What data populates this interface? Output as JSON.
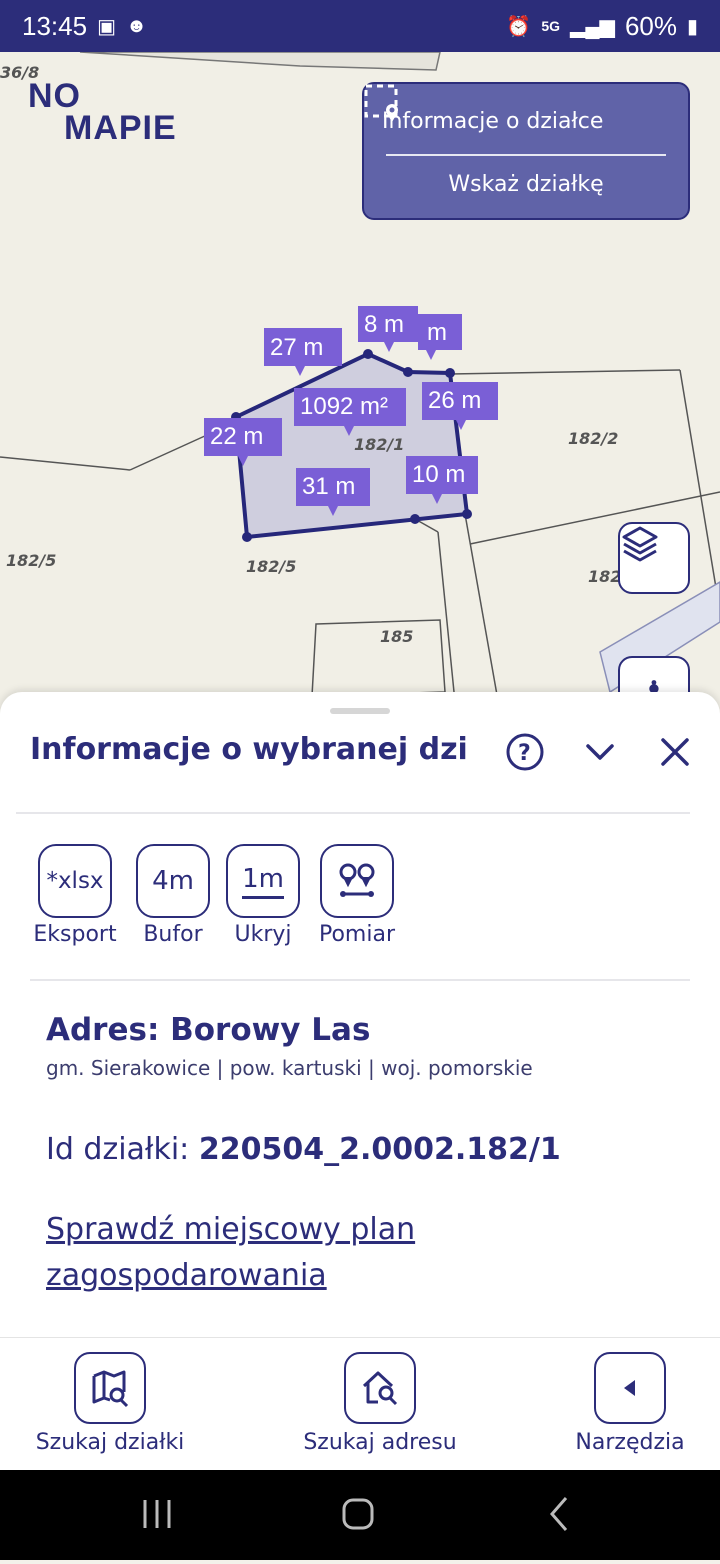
{
  "status_bar": {
    "time": "13:45",
    "network": "5G",
    "battery": "60%"
  },
  "logo": {
    "line1": "NO",
    "line2": "MAPIE"
  },
  "info_box": {
    "title": "Informacje o działce",
    "action": "Wskaż działkę"
  },
  "map": {
    "parcel_labels": [
      "36/8",
      "182/1",
      "182/2",
      "182/5",
      "182/5",
      "182",
      "185"
    ],
    "measurements": [
      "27 m",
      "8 m",
      "m",
      "1092 m²",
      "26 m",
      "22 m",
      "31 m",
      "10 m"
    ]
  },
  "sheet": {
    "title": "Informacje o wybranej dzi...",
    "tools": [
      {
        "icon": "*xlsx",
        "label": "Eksport"
      },
      {
        "icon": "4m",
        "label": "Bufor"
      },
      {
        "icon": "1m",
        "label": "Ukryj"
      },
      {
        "icon": "measure-icon",
        "label": "Pomiar"
      }
    ],
    "address_title": "Adres: Borowy Las",
    "address_sub": "gm. Sierakowice | pow. kartuski | woj. pomorskie",
    "id_label": "Id działki:",
    "id_value": "220504_2.0002.182/1",
    "plan_link": "Sprawdź miejscowy plan zagospodarowania"
  },
  "bottom_nav": [
    {
      "label": "Szukaj działki",
      "icon": "map-search-icon"
    },
    {
      "label": "Szukaj adresu",
      "icon": "home-search-icon"
    },
    {
      "label": "Narzędzia",
      "icon": "chevron-left-icon"
    }
  ],
  "colors": {
    "brand": "#2c2d7a",
    "accent": "#6063a8",
    "parcel_fill": "#c9c8dc"
  }
}
